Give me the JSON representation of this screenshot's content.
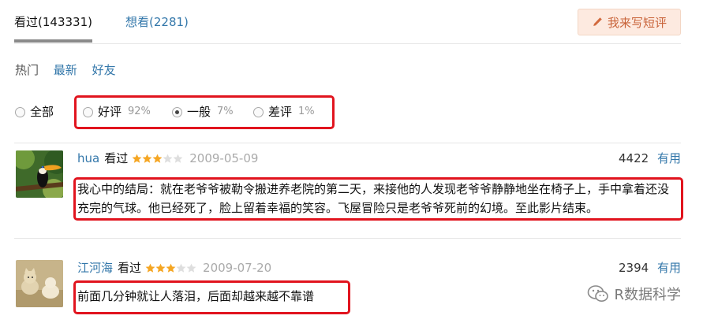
{
  "tabs": {
    "seen": "看过(143331)",
    "want": "想看(2281)",
    "write_button": "我来写短评"
  },
  "sort": {
    "items": [
      "热门",
      "最新",
      "好友"
    ]
  },
  "filter": {
    "all": "全部",
    "good": "好评",
    "good_pct": "92%",
    "neutral": "一般",
    "neutral_pct": "7%",
    "bad": "差评",
    "bad_pct": "1%",
    "selected": "一般"
  },
  "comments": [
    {
      "author": "hua",
      "status": "看过",
      "rating": 3,
      "date": "2009-05-09",
      "votes": "4422",
      "vote_label": "有用",
      "text": "我心中的结局：就在老爷爷被勒令搬进养老院的第二天，来接他的人发现老爷爷静静地坐在椅子上，手中拿着还没充完的气球。他已经死了，脸上留着幸福的笑容。飞屋冒险只是老爷爷死前的幻境。至此影片结束。"
    },
    {
      "author": "江河海",
      "status": "看过",
      "rating": 3,
      "date": "2009-07-20",
      "votes": "2394",
      "vote_label": "有用",
      "text": "前面几分钟就让人落泪，后面却越来越不靠谱"
    }
  ],
  "watermark": "R数据科学",
  "colors": {
    "link": "#3377aa",
    "highlight_box": "#e1141e",
    "star": "#f5a623",
    "write_button_bg": "#fdeae0"
  }
}
